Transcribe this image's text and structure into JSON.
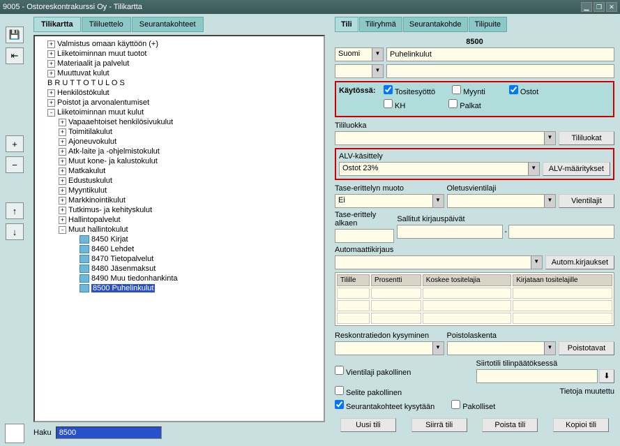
{
  "title": "9005 - Ostoreskontrakurssi Oy - Tilikartta",
  "ltabs": [
    "Tilikartta",
    "Tililuettelo",
    "Seurantakohteet"
  ],
  "rtabs": [
    "Tili",
    "Tiliryhmä",
    "Seurantakohde",
    "Tilipuite"
  ],
  "tree": [
    {
      "lvl": 1,
      "tog": "+",
      "lbl": "Valmistus omaan käyttöön (+)"
    },
    {
      "lvl": 1,
      "tog": "+",
      "lbl": "Liiketoiminnan muut tuotot"
    },
    {
      "lvl": 1,
      "tog": "+",
      "lbl": "Materiaalit ja palvelut"
    },
    {
      "lvl": 1,
      "tog": "+",
      "lbl": "Muuttuvat kulut"
    },
    {
      "lvl": 1,
      "tog": "",
      "lbl": "B R U T T O T U L O S"
    },
    {
      "lvl": 1,
      "tog": "+",
      "lbl": "Henkilöstökulut"
    },
    {
      "lvl": 1,
      "tog": "+",
      "lbl": "Poistot ja arvonalentumiset"
    },
    {
      "lvl": 1,
      "tog": "-",
      "lbl": "Liiketoiminnan muut kulut"
    },
    {
      "lvl": 2,
      "tog": "+",
      "lbl": "Vapaaehtoiset henkilösivukulut"
    },
    {
      "lvl": 2,
      "tog": "+",
      "lbl": "Toimitilakulut"
    },
    {
      "lvl": 2,
      "tog": "+",
      "lbl": "Ajoneuvokulut"
    },
    {
      "lvl": 2,
      "tog": "+",
      "lbl": "Atk-laite ja -ohjelmistokulut"
    },
    {
      "lvl": 2,
      "tog": "+",
      "lbl": "Muut kone- ja kalustokulut"
    },
    {
      "lvl": 2,
      "tog": "+",
      "lbl": "Matkakulut"
    },
    {
      "lvl": 2,
      "tog": "+",
      "lbl": "Edustuskulut"
    },
    {
      "lvl": 2,
      "tog": "+",
      "lbl": "Myyntikulut"
    },
    {
      "lvl": 2,
      "tog": "+",
      "lbl": "Markkinointikulut"
    },
    {
      "lvl": 2,
      "tog": "+",
      "lbl": "Tutkimus- ja kehityskulut"
    },
    {
      "lvl": 2,
      "tog": "+",
      "lbl": "Hallintopalvelut"
    },
    {
      "lvl": 2,
      "tog": "-",
      "lbl": "Muut hallintokulut"
    },
    {
      "lvl": 4,
      "ic": 1,
      "lbl": "8450 Kirjat"
    },
    {
      "lvl": 4,
      "ic": 1,
      "lbl": "8460 Lehdet"
    },
    {
      "lvl": 4,
      "ic": 1,
      "lbl": "8470 Tietopalvelut"
    },
    {
      "lvl": 4,
      "ic": 1,
      "lbl": "8480 Jäsenmaksut"
    },
    {
      "lvl": 4,
      "ic": 1,
      "lbl": "8490 Muu tiedonhankinta"
    },
    {
      "lvl": 4,
      "ic": 1,
      "lbl": "8500 Puhelinkulut",
      "sel": true
    }
  ],
  "search": {
    "label": "Haku",
    "value": "8500"
  },
  "acct": {
    "num": "8500",
    "lang": "Suomi",
    "name": "Puhelinkulut"
  },
  "use": {
    "label": "Käytössä:",
    "opts": [
      {
        "lbl": "Tositesyöttö",
        "ck": true
      },
      {
        "lbl": "Myynti",
        "ck": false
      },
      {
        "lbl": "Ostot",
        "ck": true
      },
      {
        "lbl": "KH",
        "ck": false
      },
      {
        "lbl": "Palkat",
        "ck": false
      }
    ]
  },
  "fld": {
    "tililuokka": "Tililuokka",
    "tililuokat_btn": "Tililuokat",
    "alv": "ALV-käsittely",
    "alv_val": "Ostot 23%",
    "alv_btn": "ALV-määritykset",
    "tase": "Tase-erittelyn muoto",
    "tase_val": "Ei",
    "olet": "Oletusvientilaji",
    "vient_btn": "Vientilajit",
    "tasea": "Tase-erittely alkaen",
    "sall": "Sallitut kirjauspäivät",
    "dash": "-",
    "autok": "Automaattikirjaus",
    "autok_btn": "Autom.kirjaukset",
    "th1": "Tilille",
    "th2": "Prosentti",
    "th3": "Koskee tositelajia",
    "th4": "Kirjataan tositelajille",
    "resk": "Reskontratiedon kysyminen",
    "poistol": "Poistolaskenta",
    "poist_btn": "Poistotavat",
    "vlp": "Vientilaji pakollinen",
    "siirto": "Siirtotili tilinpäätöksessä",
    "selp": "Selite pakollinen",
    "tiet": "Tietoja muutettu",
    "skk": "Seurantakohteet kysytään",
    "pak": "Pakolliset"
  },
  "bbtns": [
    "Uusi tili",
    "Siirrä tili",
    "Poista tili",
    "Kopioi tili"
  ]
}
